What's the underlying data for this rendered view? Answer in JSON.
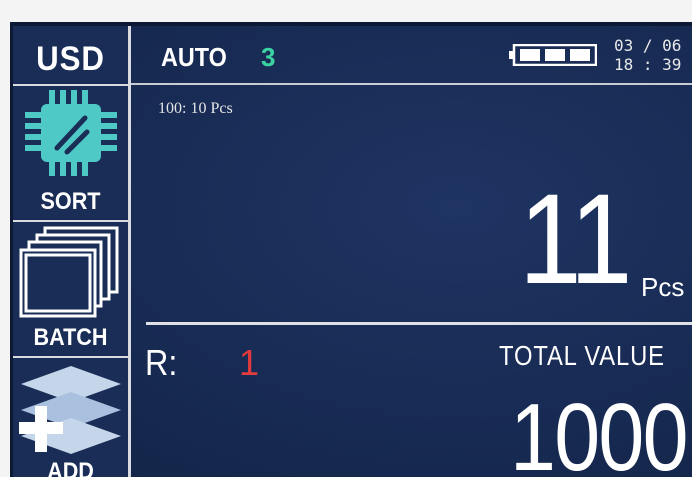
{
  "sidebar": {
    "currency": "USD",
    "items": [
      {
        "label": "SORT",
        "icon": "chip-icon"
      },
      {
        "label": "BATCH",
        "icon": "stacked-sheets-icon"
      },
      {
        "label": "ADD",
        "icon": "layers-plus-icon"
      }
    ]
  },
  "header": {
    "mode": "AUTO",
    "mode_value": "3",
    "battery_icon": "battery-icon",
    "date": "03 / 06",
    "time": "18 : 39"
  },
  "main": {
    "denomination": "100:  10 Pcs",
    "count": "11",
    "count_unit": "Pcs",
    "reject_label": "R:",
    "reject_value": "1",
    "total_value_label": "TOTAL VALUE",
    "total_value": "1000"
  },
  "colors": {
    "background": "#1a2c55",
    "mode_value": "#3cd3a3",
    "reject_value": "#e33b3b",
    "icon_teal": "#4fc9c6"
  }
}
